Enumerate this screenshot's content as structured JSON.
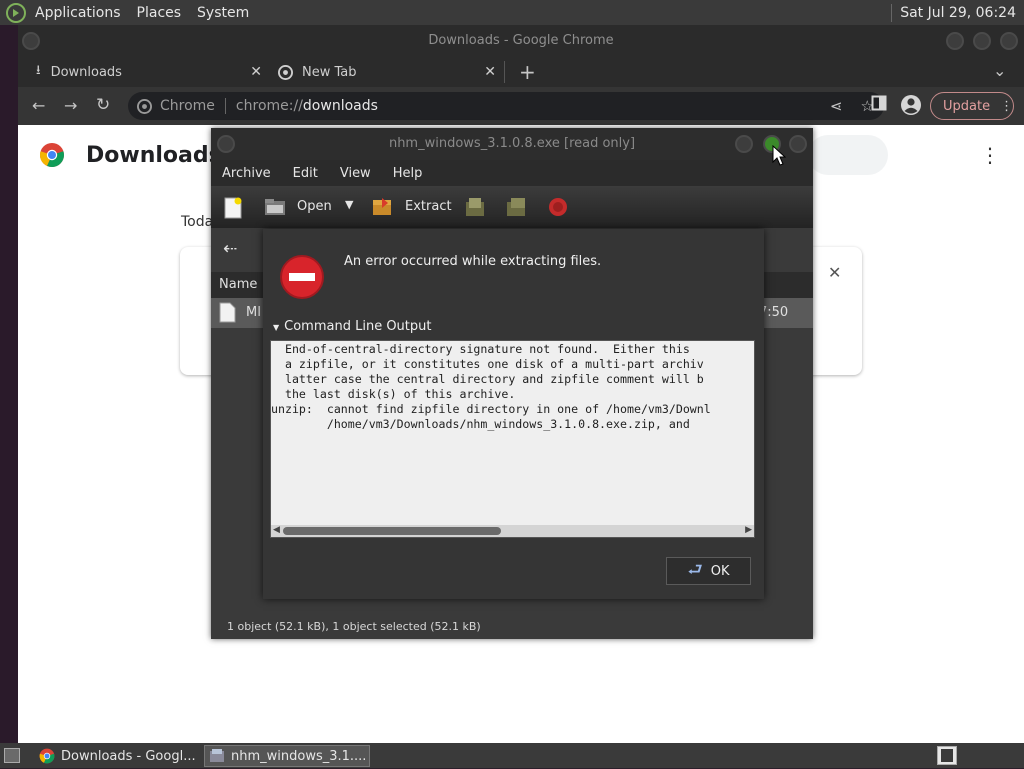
{
  "top_panel": {
    "menus": [
      "Applications",
      "Places",
      "System"
    ],
    "clock": "Sat Jul 29, 06:24"
  },
  "chrome": {
    "window_title": "Downloads - Google Chrome",
    "tabs": [
      {
        "label": "Downloads",
        "close": "✕"
      },
      {
        "label": "New Tab",
        "close": "✕"
      }
    ],
    "new_tab": "+",
    "tab_list": "⌄",
    "omnibox": {
      "site": "Chrome",
      "url_prefix": "chrome://",
      "url_path": "downloads"
    },
    "update_label": "Update",
    "page": {
      "title": "Downloads",
      "today_label": "Toda",
      "card_close": "✕",
      "menu": "⋮"
    }
  },
  "archive": {
    "window_title": "nhm_windows_3.1.0.8.exe [read only]",
    "menu": [
      "Archive",
      "Edit",
      "View",
      "Help"
    ],
    "toolbar": {
      "open_label": "Open",
      "extract_label": "Extract"
    },
    "column_name": "Name",
    "row_name_fragment": "MI",
    "row_time_fragment": "7:50",
    "status": "1 object (52.1 kB), 1 object selected (52.1 kB)"
  },
  "error_dialog": {
    "message": "An error occurred while extracting files.",
    "expander_label": "Command Line Output",
    "output_lines": [
      "  End-of-central-directory signature not found.  Either this",
      "  a zipfile, or it constitutes one disk of a multi-part archiv",
      "  latter case the central directory and zipfile comment will b",
      "  the last disk(s) of this archive.",
      "unzip:  cannot find zipfile directory in one of /home/vm3/Downl",
      "        /home/vm3/Downloads/nhm_windows_3.1.0.8.exe.zip, and"
    ],
    "ok_label": "OK"
  },
  "taskbar": {
    "items": [
      {
        "label": "Downloads - Googl..."
      },
      {
        "label": "nhm_windows_3.1...."
      }
    ]
  }
}
